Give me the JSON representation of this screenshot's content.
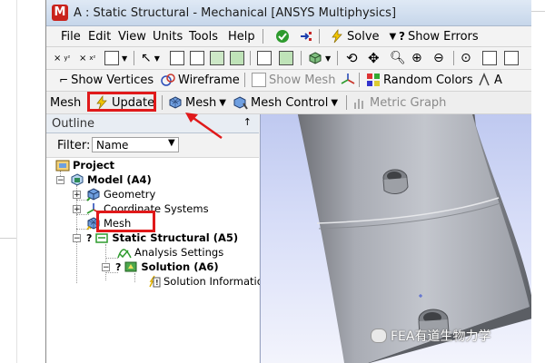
{
  "window": {
    "title": "A : Static Structural - Mechanical [ANSYS Multiphysics]",
    "app_icon_letter": "M"
  },
  "menu": {
    "items": [
      "File",
      "Edit",
      "View",
      "Units",
      "Tools",
      "Help"
    ],
    "solve_label": "Solve",
    "show_errors_label": "Show Errors"
  },
  "toolbar2": {
    "show_vertices": "Show Vertices",
    "wireframe": "Wireframe",
    "show_mesh": "Show Mesh",
    "random_colors": "Random Colors"
  },
  "toolbar3": {
    "context_label": "Mesh",
    "update": "Update",
    "mesh_menu": "Mesh",
    "mesh_control": "Mesh Control",
    "metric_graph": "Metric Graph"
  },
  "outline": {
    "title": "Outline",
    "pin": "↑",
    "filter_label": "Filter:",
    "filter_value": "Name",
    "tree": {
      "project": "Project",
      "model": "Model (A4)",
      "geometry": "Geometry",
      "coordinate_systems": "Coordinate Systems",
      "mesh": "Mesh",
      "static_structural": "Static Structural (A5)",
      "analysis_settings": "Analysis Settings",
      "solution": "Solution (A6)",
      "solution_information": "Solution Informatio"
    }
  },
  "watermark": "FEA有道生物力学",
  "colors": {
    "highlight": "#e0191a",
    "viewport_top": "#bfc9f0",
    "viewport_bottom": "#f3f4fc",
    "part_gray": "#a9acb4"
  },
  "icons": [
    "ansys-mechanical-icon",
    "check-icon",
    "solve-lightning-icon",
    "wireframe-icon",
    "random-colors-icon",
    "update-lightning-icon",
    "mesh-icon",
    "mesh-control-icon",
    "metric-graph-icon",
    "pin-icon",
    "project-icon",
    "model-icon",
    "geometry-icon",
    "coordinate-systems-icon",
    "static-structural-icon",
    "analysis-settings-icon",
    "solution-icon",
    "solution-information-icon"
  ]
}
